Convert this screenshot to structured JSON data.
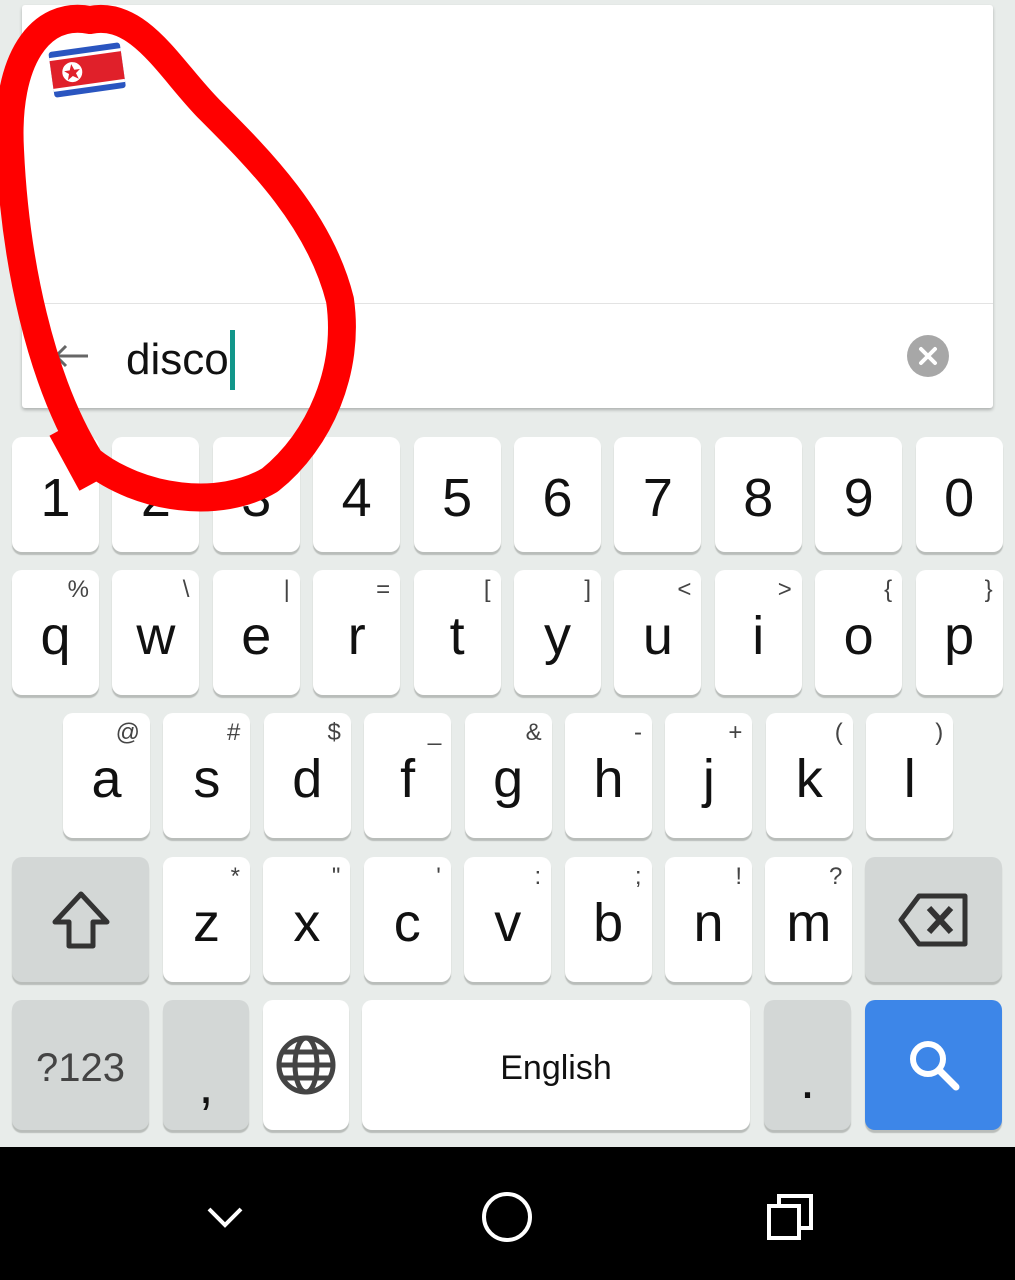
{
  "search": {
    "query": "disco",
    "flag_icon": "north-korea-flag-icon",
    "clear_icon": "clear-icon",
    "back_icon": "back-arrow-icon"
  },
  "keyboard": {
    "rows": [
      [
        {
          "k": "1"
        },
        {
          "k": "2"
        },
        {
          "k": "3"
        },
        {
          "k": "4"
        },
        {
          "k": "5"
        },
        {
          "k": "6"
        },
        {
          "k": "7"
        },
        {
          "k": "8"
        },
        {
          "k": "9"
        },
        {
          "k": "0"
        }
      ],
      [
        {
          "k": "q",
          "h": "%"
        },
        {
          "k": "w",
          "h": "\\"
        },
        {
          "k": "e",
          "h": "|"
        },
        {
          "k": "r",
          "h": "="
        },
        {
          "k": "t",
          "h": "["
        },
        {
          "k": "y",
          "h": "]"
        },
        {
          "k": "u",
          "h": "<"
        },
        {
          "k": "i",
          "h": ">"
        },
        {
          "k": "o",
          "h": "{"
        },
        {
          "k": "p",
          "h": "}"
        }
      ],
      [
        {
          "k": "a",
          "h": "@"
        },
        {
          "k": "s",
          "h": "#"
        },
        {
          "k": "d",
          "h": "$"
        },
        {
          "k": "f",
          "h": "_"
        },
        {
          "k": "g",
          "h": "&"
        },
        {
          "k": "h",
          "h": "-"
        },
        {
          "k": "j",
          "h": "+"
        },
        {
          "k": "k",
          "h": "("
        },
        {
          "k": "l",
          "h": ")"
        }
      ],
      [
        {
          "k": "z",
          "h": "*"
        },
        {
          "k": "x",
          "h": "\""
        },
        {
          "k": "c",
          "h": "'"
        },
        {
          "k": "v",
          "h": ":"
        },
        {
          "k": "b",
          "h": ";"
        },
        {
          "k": "n",
          "h": "!"
        },
        {
          "k": "m",
          "h": "?"
        }
      ]
    ],
    "symbols_label": "?123",
    "comma": ",",
    "space_label": "English",
    "period": ".",
    "accent": "#3d86e8"
  },
  "nav": {
    "icons": [
      "back-chevron-icon",
      "home-circle-icon",
      "recents-icon"
    ]
  },
  "annotation": {
    "color": "#ff0000",
    "shape": "hand-drawn loop"
  }
}
